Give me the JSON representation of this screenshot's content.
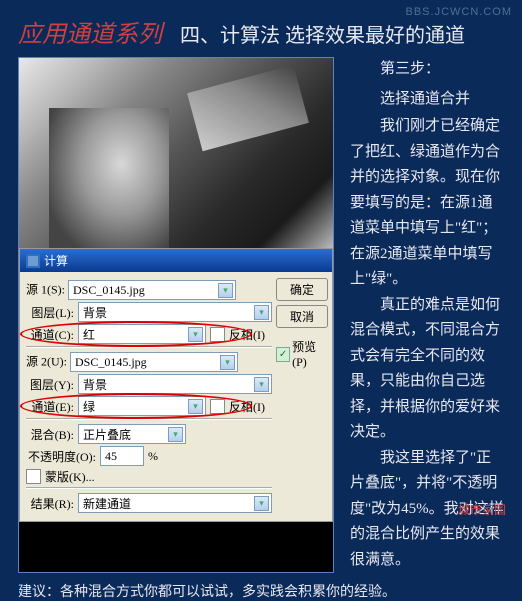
{
  "watermark_top": "BBS.JCWCN.COM",
  "watermark_bottom": "城市家园",
  "header": {
    "series": "应用通道系列",
    "topic": "四、计算法 选择效果最好的通道"
  },
  "dialog": {
    "title": "计算",
    "source1_label": "源 1(S):",
    "source2_label": "源 2(U):",
    "layer_label1": "图层(L):",
    "layer_label2": "图层(Y):",
    "channel_label1": "通道(C):",
    "channel_label2": "通道(E):",
    "invert_label": "反相(I)",
    "file": "DSC_0145.jpg",
    "layer_value": "背景",
    "channel1": "红",
    "channel2": "绿",
    "blend_label": "混合(B):",
    "blend_value": "正片叠底",
    "opacity_label": "不透明度(O):",
    "opacity_value": "45",
    "percent": "%",
    "mask_label": "蒙版(K)...",
    "result_label": "结果(R):",
    "result_value": "新建通道",
    "btn_ok": "确定",
    "btn_cancel": "取消",
    "btn_preview": "预览(P)"
  },
  "text": {
    "step": "第三步：",
    "sub": "选择通道合并",
    "p1": "我们刚才已经确定了把红、绿通道作为合并的选择对象。现在你要填写的是：在源1通道菜单中填写上\"红\"；在源2通道菜单中填写上\"绿\"。",
    "p2": "真正的难点是如何混合模式，不同混合方式会有完全不同的效果，只能由你自己选择，并根据你的爱好来决定。",
    "p3": "我这里选择了\"正片叠底\"，并将\"不透明度\"改为45%。我对这样的混合比例产生的效果很满意。"
  },
  "bottom_tip": "建议：各种混合方式你都可以试试，多实践会积累你的经验。"
}
